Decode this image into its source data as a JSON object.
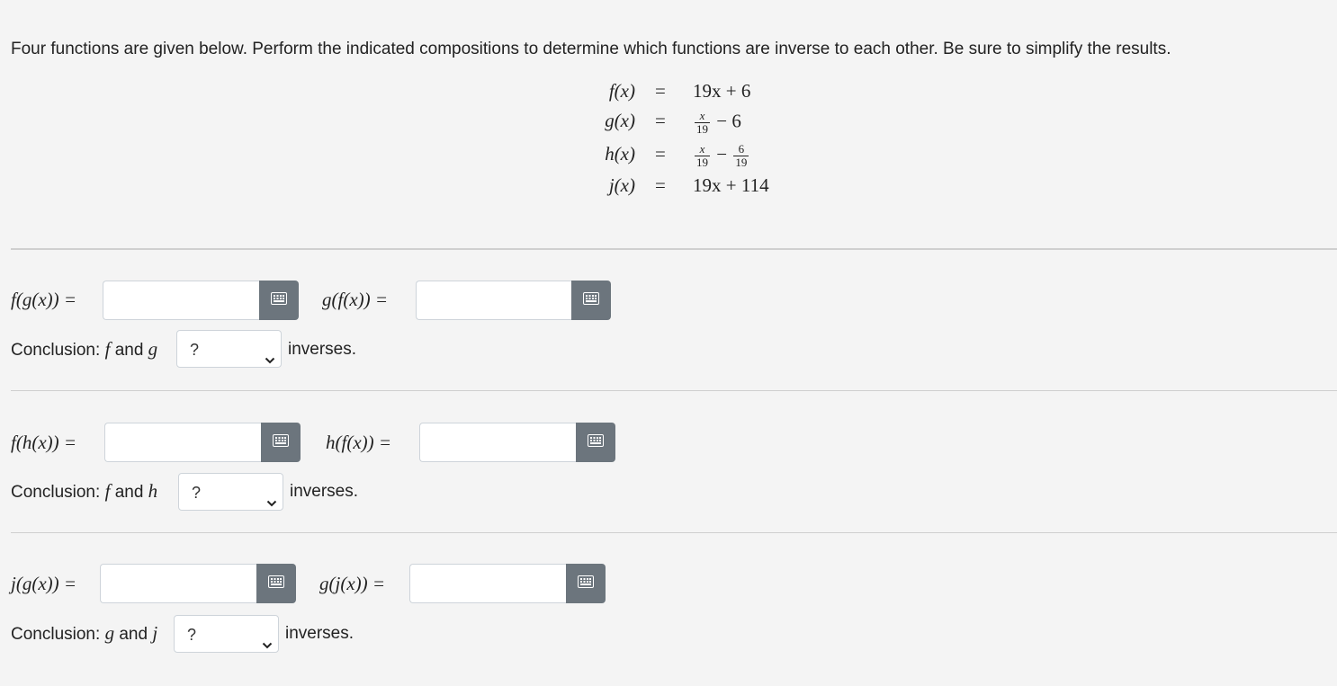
{
  "prompt": "Four functions are given below. Perform the indicated compositions to determine which functions are inverse to each other. Be sure to simplify the results.",
  "definitions": [
    {
      "lhs": "f(x)",
      "eq": "=",
      "rhs": "19x + 6"
    },
    {
      "lhs": "g(x)",
      "eq": "=",
      "rhs_frac_num": "x",
      "rhs_frac_den": "19",
      "rhs_tail": "− 6"
    },
    {
      "lhs": "h(x)",
      "eq": "=",
      "rhs_frac_num": "x",
      "rhs_frac_den": "19",
      "rhs_mid": "−",
      "rhs_frac2_num": "6",
      "rhs_frac2_den": "19"
    },
    {
      "lhs": "j(x)",
      "eq": "=",
      "rhs": "19x + 114"
    }
  ],
  "sections": [
    {
      "left_label": "f(g(x)) =",
      "right_label": "g(f(x)) =",
      "left_value": "",
      "right_value": "",
      "conclusion_prefix": "Conclusion:",
      "var1": "f",
      "conj": "and",
      "var2": "g",
      "select_value": "?",
      "suffix": "inverses."
    },
    {
      "left_label": "f(h(x)) =",
      "right_label": "h(f(x)) =",
      "left_value": "",
      "right_value": "",
      "conclusion_prefix": "Conclusion:",
      "var1": "f",
      "conj": "and",
      "var2": "h",
      "select_value": "?",
      "suffix": "inverses."
    },
    {
      "left_label": "j(g(x)) =",
      "right_label": "g(j(x)) =",
      "left_value": "",
      "right_value": "",
      "conclusion_prefix": "Conclusion:",
      "var1": "g",
      "conj": "and",
      "var2": "j",
      "select_value": "?",
      "suffix": "inverses."
    }
  ],
  "icons": {
    "keyboard": "keyboard-icon",
    "chevron": "chevron-down-icon"
  },
  "colors": {
    "button": "#6c757d",
    "background": "#f4f4f4"
  }
}
